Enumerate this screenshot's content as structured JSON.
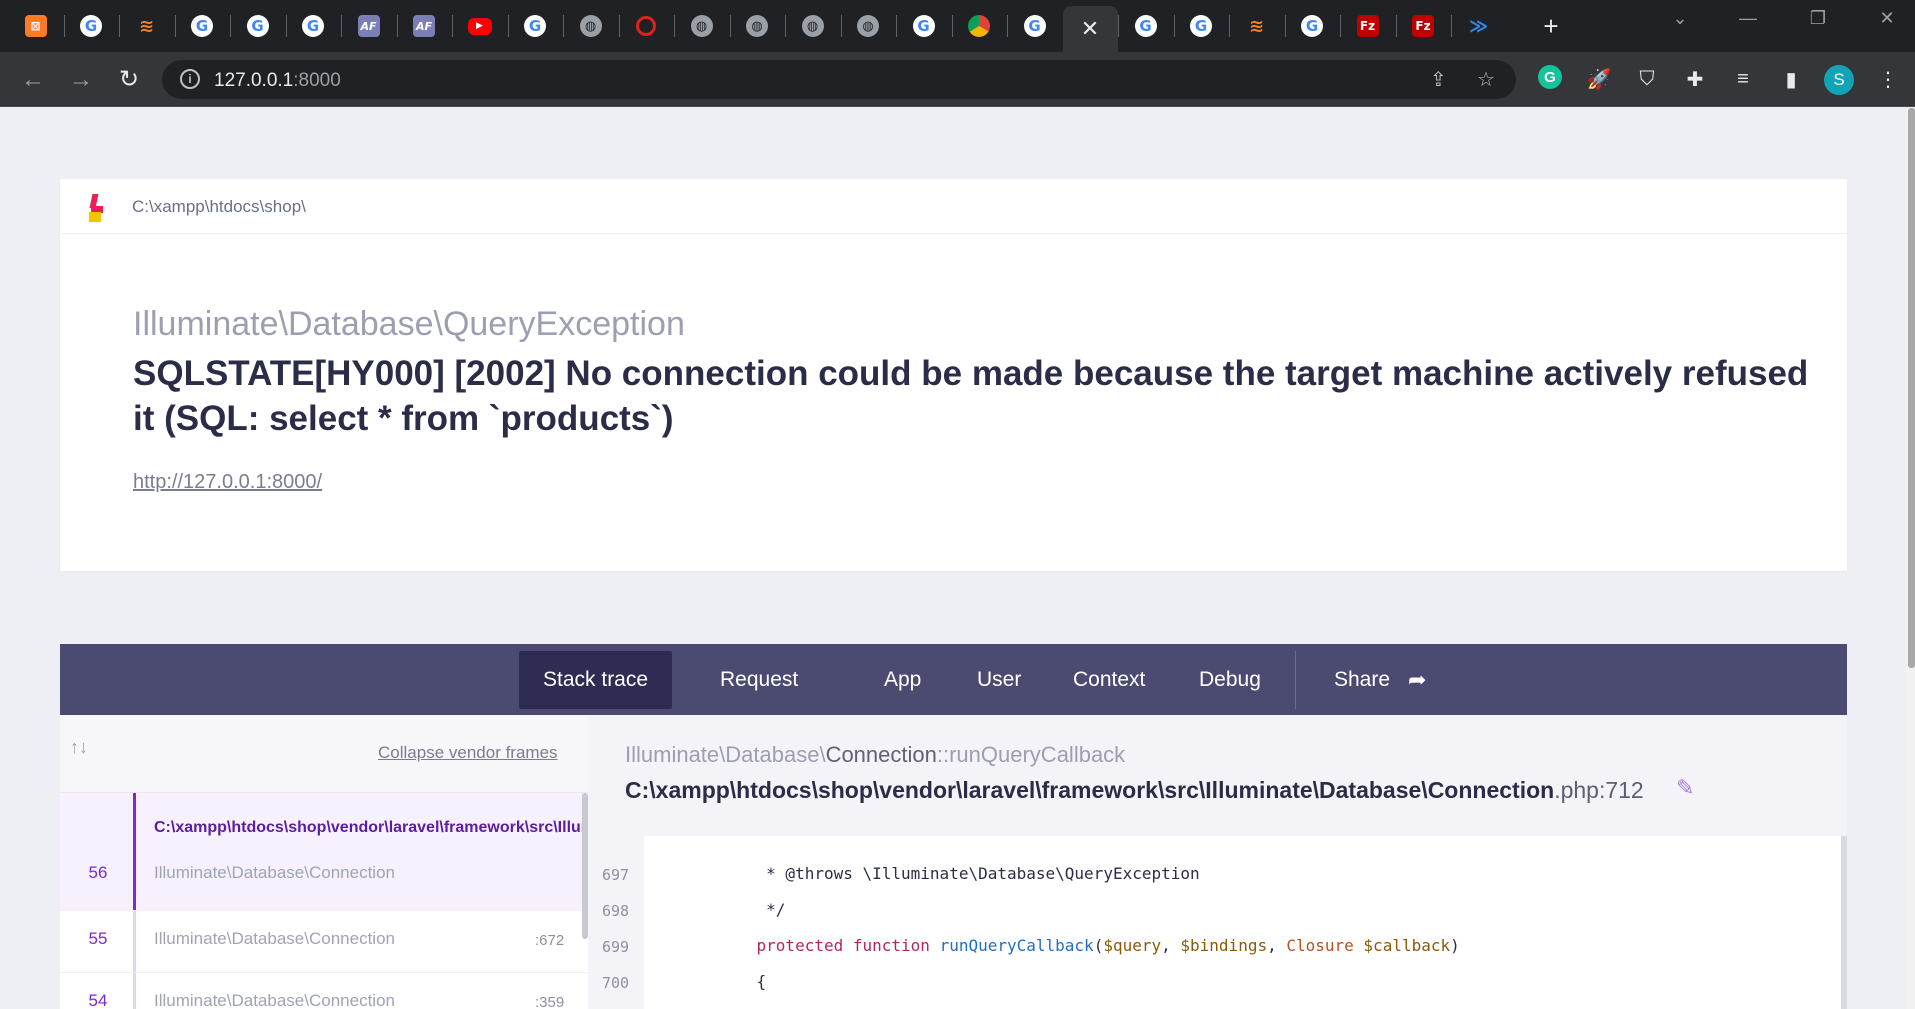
{
  "browser": {
    "url_host": "127.0.0.1",
    "url_port": ":8000",
    "tabs": [
      {
        "icon": "xampp-icon",
        "glyph": "⊠"
      },
      {
        "icon": "google-icon",
        "glyph": "G"
      },
      {
        "icon": "stackoverflow-icon",
        "glyph": "≋"
      },
      {
        "icon": "google-icon",
        "glyph": "G"
      },
      {
        "icon": "google-icon",
        "glyph": "G"
      },
      {
        "icon": "google-icon",
        "glyph": "G"
      },
      {
        "icon": "af-icon",
        "glyph": "AF"
      },
      {
        "icon": "af-icon",
        "glyph": "AF"
      },
      {
        "icon": "youtube-icon",
        "glyph": "▶"
      },
      {
        "icon": "google-icon",
        "glyph": "G"
      },
      {
        "icon": "globe-icon",
        "glyph": "◍"
      },
      {
        "icon": "quora-icon",
        "glyph": ""
      },
      {
        "icon": "globe-icon",
        "glyph": "◍"
      },
      {
        "icon": "globe-icon",
        "glyph": "◍"
      },
      {
        "icon": "globe-icon",
        "glyph": "◍"
      },
      {
        "icon": "globe-icon",
        "glyph": "◍"
      },
      {
        "icon": "google-icon",
        "glyph": "G"
      },
      {
        "icon": "chrome-icon",
        "glyph": ""
      },
      {
        "icon": "google-icon",
        "glyph": "G"
      },
      {
        "icon": "close-icon",
        "glyph": "✕"
      },
      {
        "icon": "google-icon",
        "glyph": "G"
      },
      {
        "icon": "google-icon",
        "glyph": "G"
      },
      {
        "icon": "stackoverflow-icon",
        "glyph": "≋"
      },
      {
        "icon": "google-icon",
        "glyph": "G"
      },
      {
        "icon": "filezilla-icon",
        "glyph": "Fz"
      },
      {
        "icon": "filezilla-icon",
        "glyph": "Fz"
      },
      {
        "icon": "vscode-icon",
        "glyph": "≫"
      }
    ],
    "profile_initial": "S",
    "grammarly_initial": "G"
  },
  "error": {
    "app_path": "C:\\xampp\\htdocs\\shop\\",
    "exception_class": "Illuminate\\Database\\QueryException",
    "message": "SQLSTATE[HY000] [2002] No connection could be made because the target machine actively refused it (SQL: select * from `products`)",
    "url": "http://127.0.0.1:8000/"
  },
  "tabs": [
    "Stack trace",
    "Request",
    "App",
    "User",
    "Context",
    "Debug"
  ],
  "share_label": "Share",
  "frames": {
    "collapse_label": "Collapse vendor frames",
    "items": [
      {
        "number": "56",
        "file": "C:\\xampp\\htdocs\\shop\\vendor\\laravel\\framework\\src\\Illuminate\\Database\\Connection.php",
        "class": "Illuminate\\Database\\Connection",
        "line": ""
      },
      {
        "number": "55",
        "file": "",
        "class": "Illuminate\\Database\\Connection",
        "line": ":672"
      },
      {
        "number": "54",
        "file": "",
        "class": "Illuminate\\Database\\Connection",
        "line": ":359"
      }
    ]
  },
  "code": {
    "class_ns": "Illuminate\\Database\\",
    "class_name": "Connection",
    "method": "::runQueryCallback",
    "path": "C:\\xampp\\htdocs\\shop\\vendor\\laravel\\framework\\src\\Illuminate\\Database\\Connection",
    "ext_line": ".php:712",
    "lines": [
      {
        "num": "697",
        "text": "     * @throws \\Illuminate\\Database\\QueryException"
      },
      {
        "num": "698",
        "text": "     */"
      },
      {
        "num": "699",
        "kw": "protected function ",
        "fn": "runQueryCallback",
        "p1": "(",
        "v1": "$query",
        "c1": ", ",
        "v2": "$bindings",
        "c2": ", ",
        "cls": "Closure ",
        "v3": "$callback",
        "p2": ")"
      },
      {
        "num": "700",
        "text": "    {"
      }
    ]
  },
  "colors": {
    "accent": "#7b2bc7",
    "tab_bar": "#4b4b72",
    "tab_active": "#2e2c52",
    "message": "#2b2d48"
  }
}
